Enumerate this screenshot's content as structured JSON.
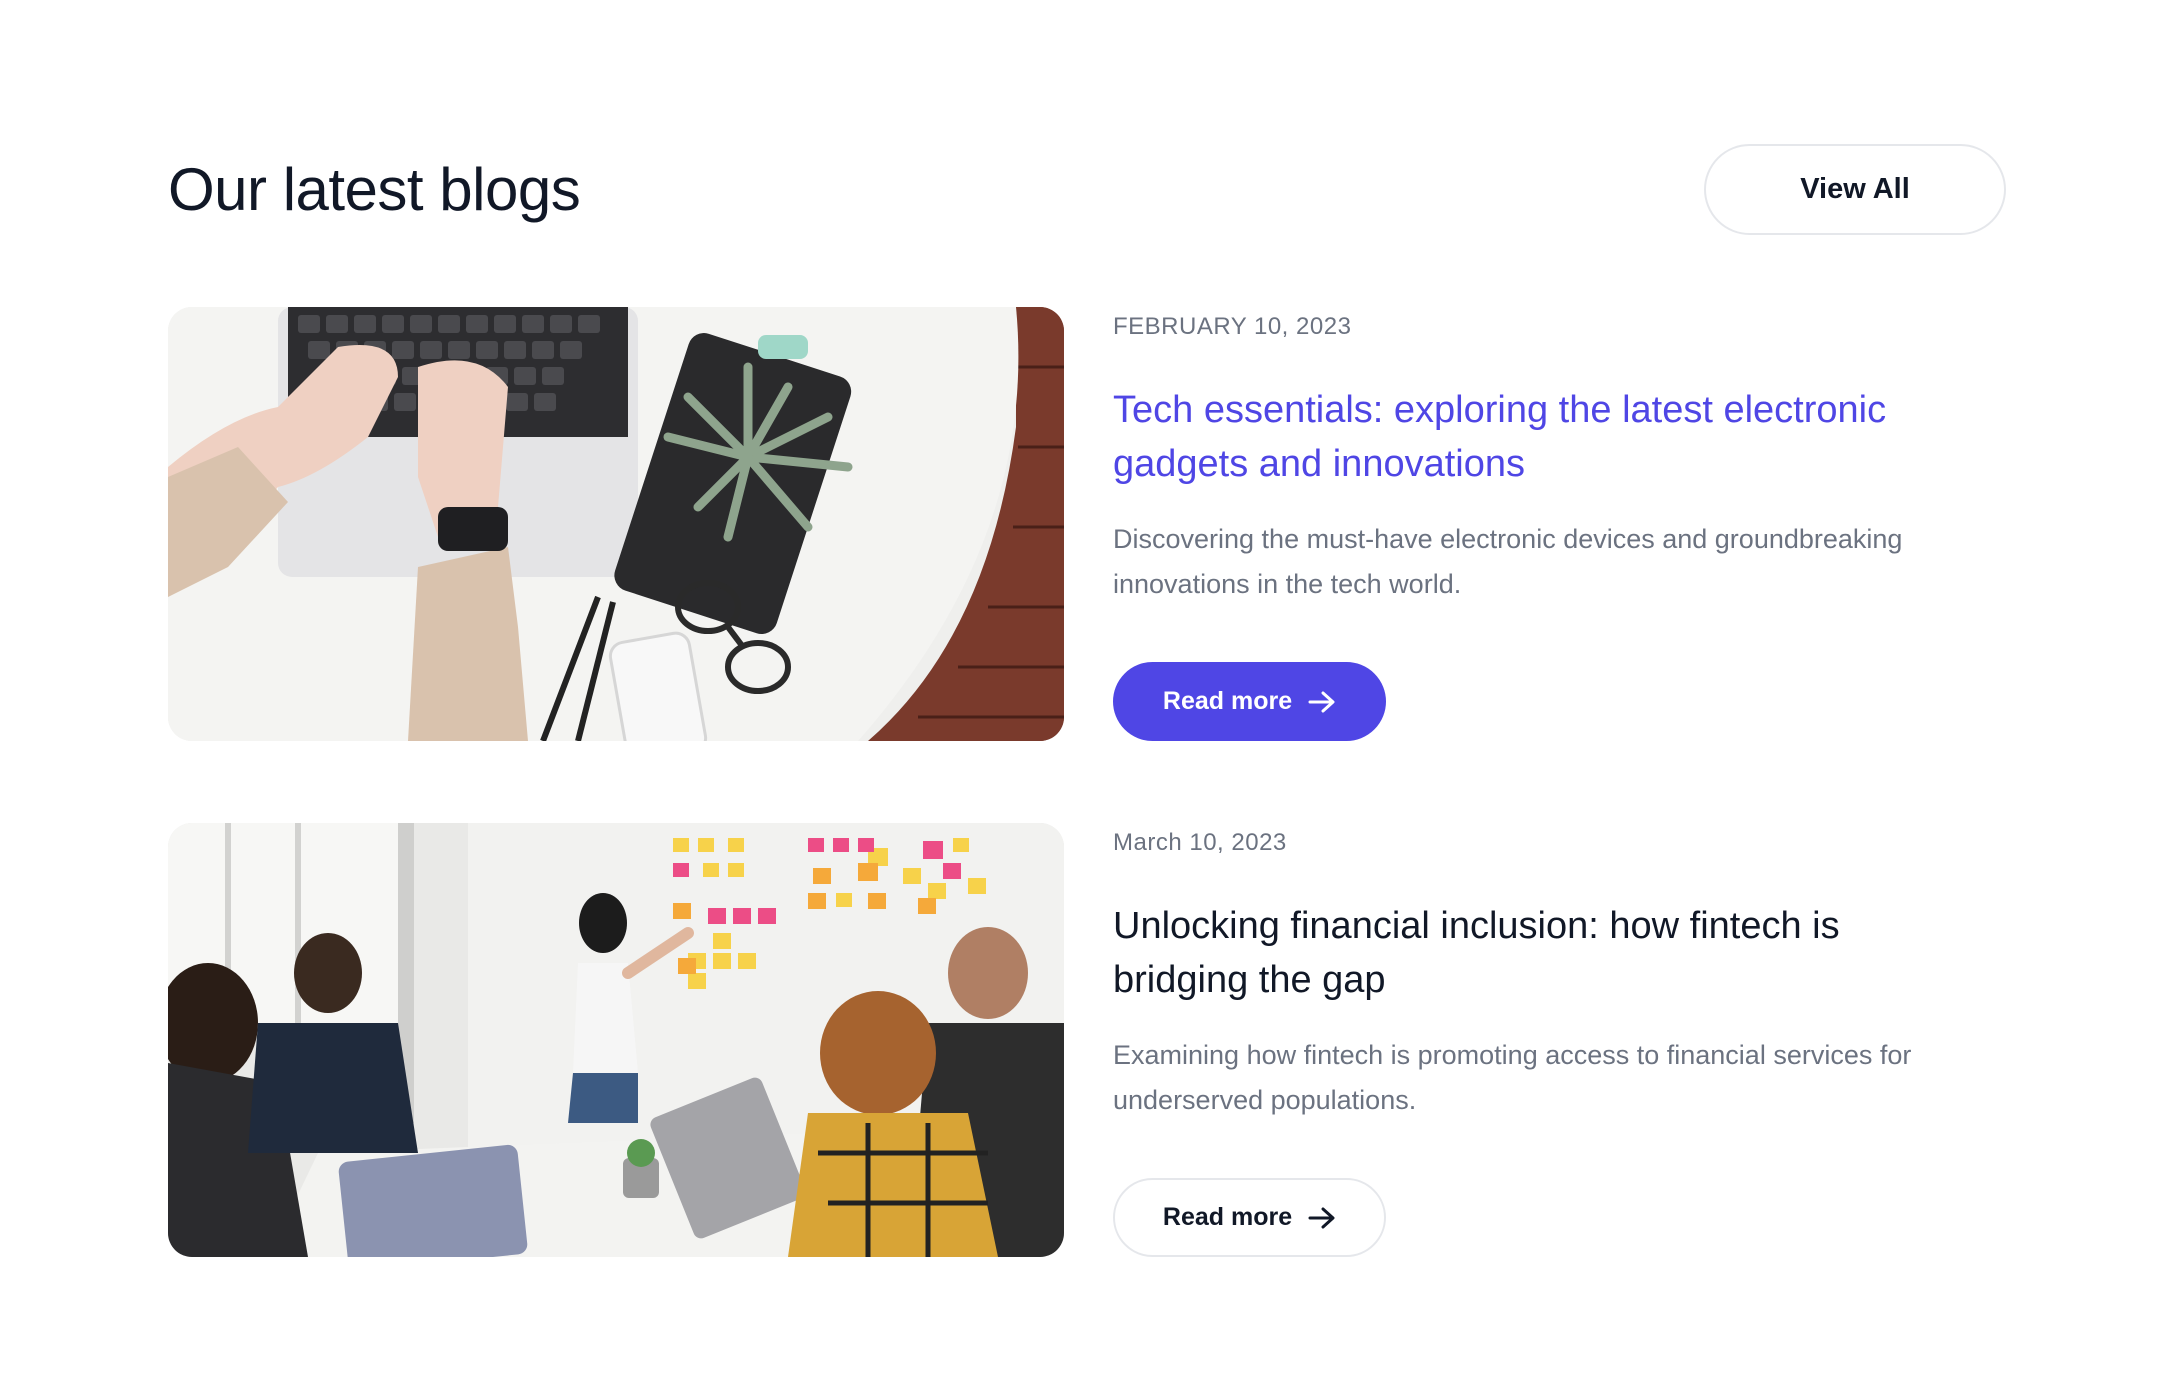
{
  "header": {
    "title": "Our latest blogs",
    "view_all_label": "View All"
  },
  "colors": {
    "accent": "#4f46e5",
    "text": "#111827",
    "muted": "#6b7280",
    "border": "#e5e7eb"
  },
  "posts": [
    {
      "date": "FEBRUARY 10, 2023",
      "title": "Tech essentials: exploring the latest electronic gadgets and innovations",
      "excerpt": "Discovering the must-have electronic devices and groundbreaking innovations in the tech world.",
      "button_label": "Read more",
      "button_icon": "arrow-right-icon"
    },
    {
      "date": "March 10, 2023",
      "title": "Unlocking financial inclusion: how fintech is bridging the gap",
      "excerpt": "Examining how fintech is promoting access to financial services for underserved populations.",
      "button_label": "Read more",
      "button_icon": "arrow-right-icon"
    }
  ]
}
